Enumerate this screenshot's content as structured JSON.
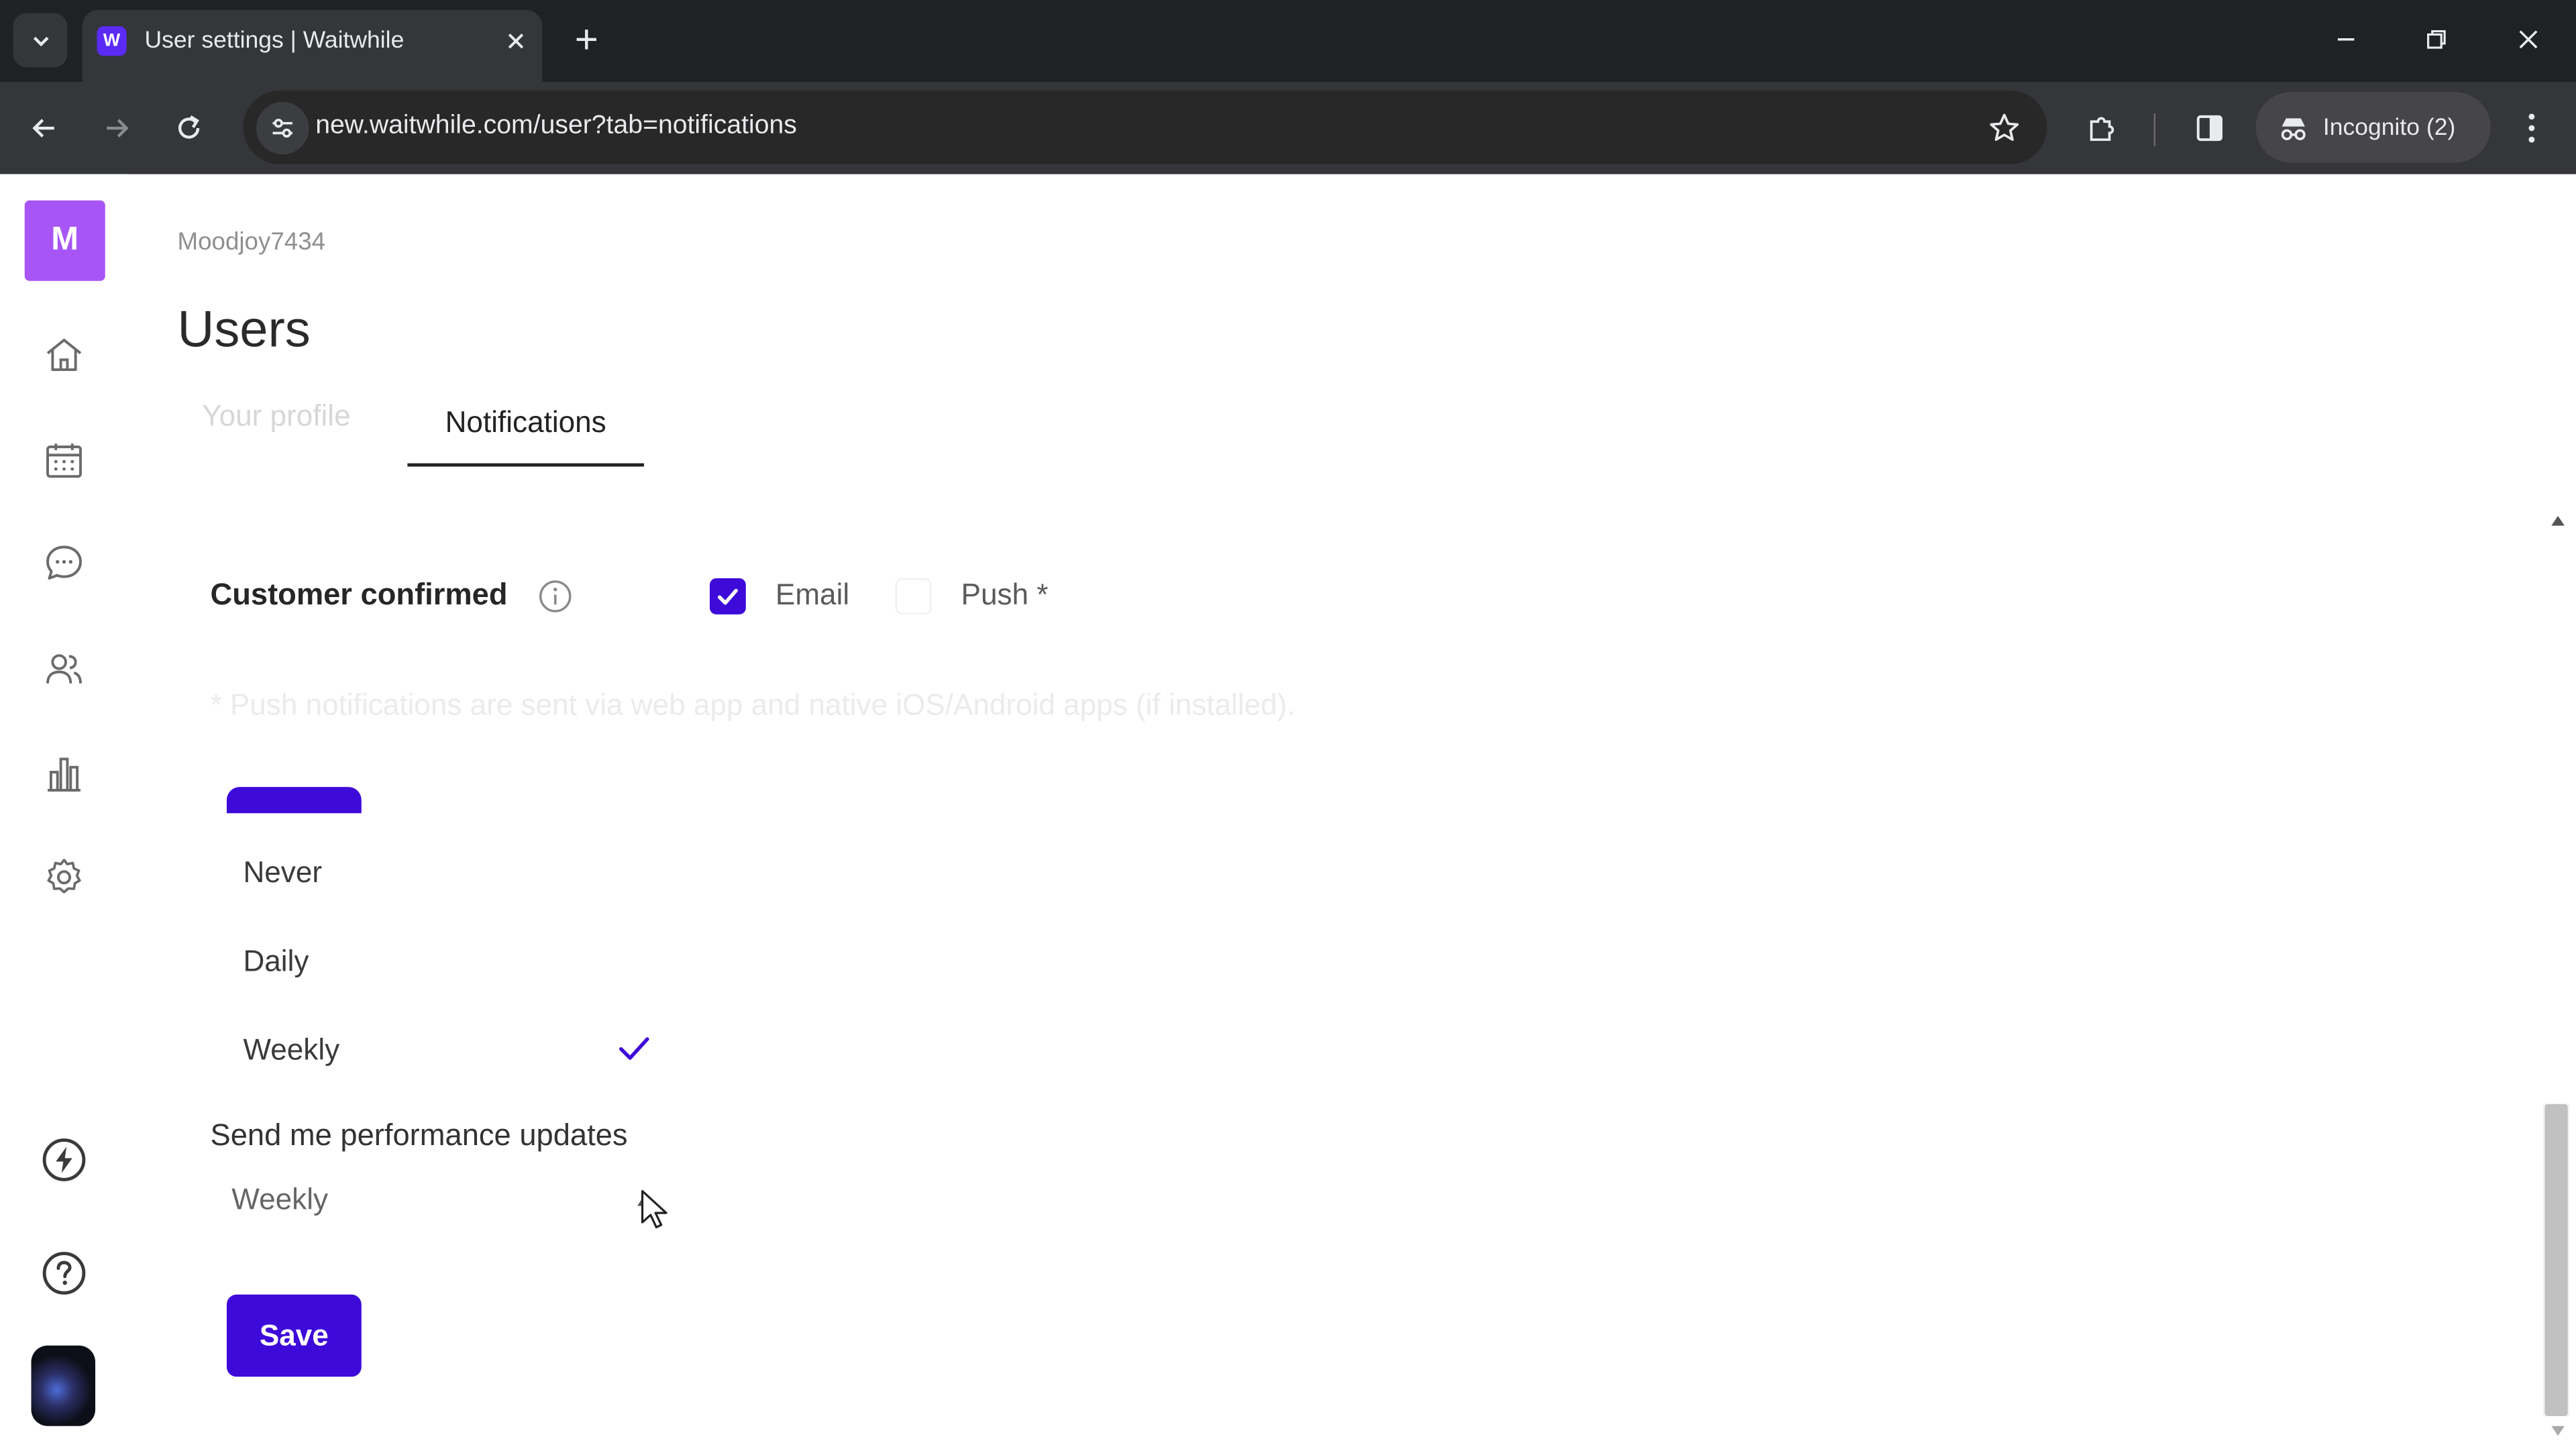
{
  "browser": {
    "tab_title": "User settings | Waitwhile",
    "favicon_letter": "W",
    "url": "new.waitwhile.com/user?tab=notifications",
    "incognito_label": "Incognito (2)"
  },
  "sidebar": {
    "logo_letter": "M",
    "logo_color": "#a855f7",
    "items": [
      {
        "name": "home-icon"
      },
      {
        "name": "calendar-icon"
      },
      {
        "name": "chat-icon"
      },
      {
        "name": "users-icon"
      },
      {
        "name": "analytics-icon"
      },
      {
        "name": "settings-icon"
      },
      {
        "name": "bolt-icon"
      },
      {
        "name": "help-icon"
      }
    ]
  },
  "header": {
    "account_name": "Moodjoy7434",
    "page_title": "Users"
  },
  "tabs": {
    "profile": "Your profile",
    "notifications": "Notifications",
    "active": "Notifications"
  },
  "notification_setting": {
    "label": "Customer confirmed",
    "email_label": "Email",
    "email_checked": true,
    "push_label": "Push *",
    "push_checked": false,
    "push_note": "* Push notifications are sent via web app and native iOS/Android apps (if installed)."
  },
  "frequency_menu": {
    "options": [
      "Never",
      "Daily",
      "Weekly"
    ],
    "selected": "Weekly"
  },
  "performance_updates": {
    "label": "Send me performance updates",
    "value": "Weekly"
  },
  "actions": {
    "save_label": "Save"
  },
  "colors": {
    "accent": "#3d0ad9",
    "chrome_dark": "#202124",
    "chrome_toolbar": "#35363a"
  }
}
